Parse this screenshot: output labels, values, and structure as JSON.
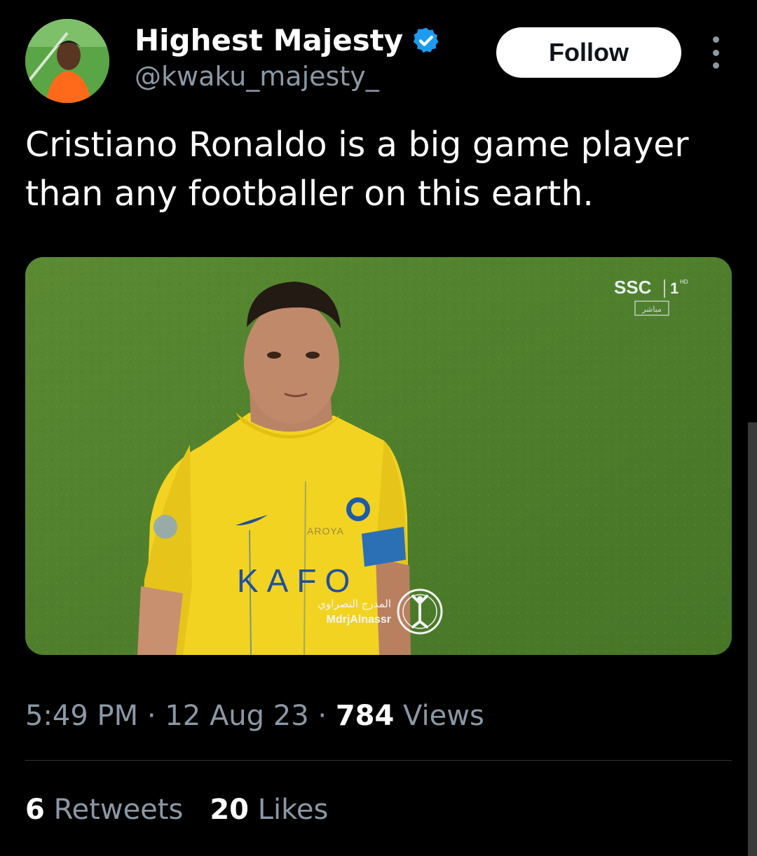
{
  "author": {
    "display_name": "Highest Majesty",
    "handle": "@kwaku_majesty_",
    "verified": true
  },
  "follow_label": "Follow",
  "tweet": {
    "text": "Cristiano Ronaldo is a big game player than any footballer on this earth."
  },
  "media": {
    "broadcaster_logo": "SSC",
    "channel_number": "1",
    "channel_hd": "HD",
    "live_label": "مباشر",
    "sponsor": "AROYA",
    "shirt_text": "KAFO",
    "watermark_arabic": "المدرج النصراوي",
    "watermark_latin": "MdrjAlnassr"
  },
  "meta": {
    "time": "5:49 PM",
    "separator": "·",
    "date": "12 Aug 23",
    "views_count": "784",
    "views_label": "Views"
  },
  "stats": {
    "retweets_count": "6",
    "retweets_label": "Retweets",
    "likes_count": "20",
    "likes_label": "Likes"
  },
  "colors": {
    "background": "#000000",
    "text_primary": "#ffffff",
    "text_secondary": "#8b98a5",
    "verified_badge": "#1d9bf0",
    "divider": "#2f3336",
    "pitch_green": "#4f7f2c",
    "jersey_yellow": "#f2d321"
  }
}
